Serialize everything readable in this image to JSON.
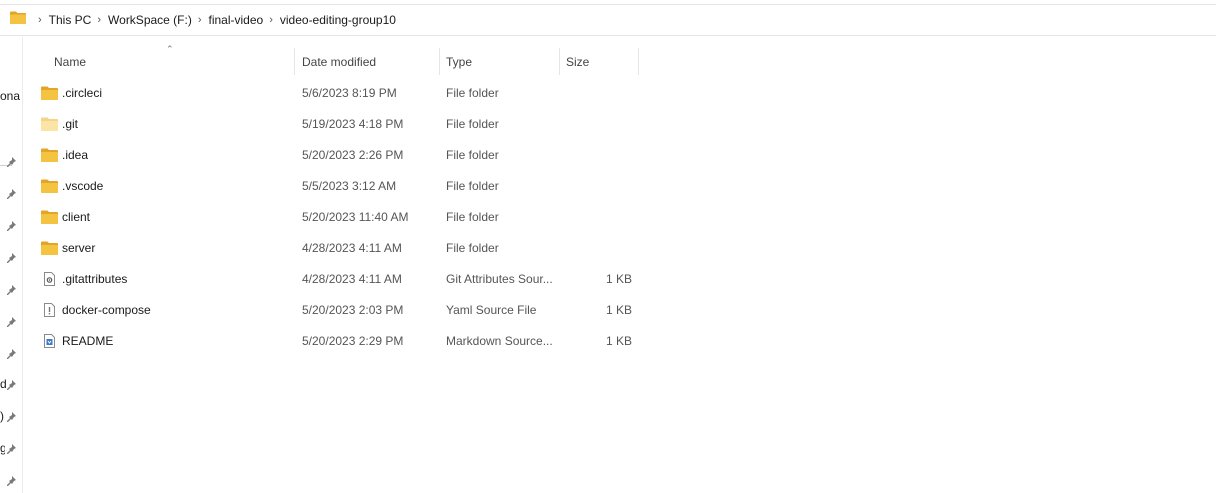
{
  "address": {
    "breadcrumbs": [
      "This PC",
      "WorkSpace (F:)",
      "final-video",
      "video-editing-group10"
    ]
  },
  "nav": {
    "partial_labels": [
      "ona",
      "d",
      ")",
      "g"
    ]
  },
  "columns": {
    "name": "Name",
    "date": "Date modified",
    "type": "Type",
    "size": "Size"
  },
  "files": [
    {
      "name": ".circleci",
      "date": "5/6/2023 8:19 PM",
      "type": "File folder",
      "size": "",
      "icon": "folder-icon",
      "faded": false
    },
    {
      "name": ".git",
      "date": "5/19/2023 4:18 PM",
      "type": "File folder",
      "size": "",
      "icon": "folder-icon",
      "faded": true
    },
    {
      "name": ".idea",
      "date": "5/20/2023 2:26 PM",
      "type": "File folder",
      "size": "",
      "icon": "folder-icon",
      "faded": false
    },
    {
      "name": ".vscode",
      "date": "5/5/2023 3:12 AM",
      "type": "File folder",
      "size": "",
      "icon": "folder-icon",
      "faded": false
    },
    {
      "name": "client",
      "date": "5/20/2023 11:40 AM",
      "type": "File folder",
      "size": "",
      "icon": "folder-icon",
      "faded": false
    },
    {
      "name": "server",
      "date": "4/28/2023 4:11 AM",
      "type": "File folder",
      "size": "",
      "icon": "folder-icon",
      "faded": false
    },
    {
      "name": ".gitattributes",
      "date": "4/28/2023 4:11 AM",
      "type": "Git Attributes Sour...",
      "size": "1 KB",
      "icon": "gitattributes-file-icon",
      "faded": false
    },
    {
      "name": "docker-compose",
      "date": "5/20/2023 2:03 PM",
      "type": "Yaml Source File",
      "size": "1 KB",
      "icon": "yaml-file-icon",
      "faded": false
    },
    {
      "name": "README",
      "date": "5/20/2023 2:29 PM",
      "type": "Markdown Source...",
      "size": "1 KB",
      "icon": "markdown-file-icon",
      "faded": false
    }
  ],
  "colors": {
    "folder": "#f5c342",
    "folder_dark": "#e2a52a",
    "folder_faded": "#fbe4a6"
  }
}
